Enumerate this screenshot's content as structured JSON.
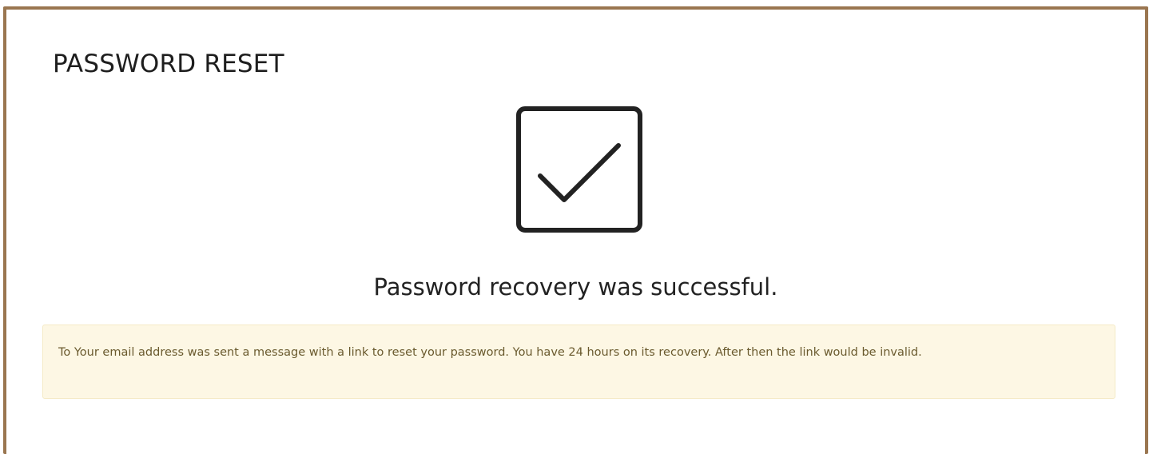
{
  "title": "PASSWORD RESET",
  "status_icon": "checkbox-check-icon",
  "success_message": "Password recovery was successful.",
  "notice": "To Your email address was sent a message with a link to reset your password. You have 24 hours on its recovery. After then the link would be invalid.",
  "colors": {
    "border": "#9a7650",
    "alert_background": "#fdf7e4",
    "alert_text": "#6a5a2e"
  }
}
